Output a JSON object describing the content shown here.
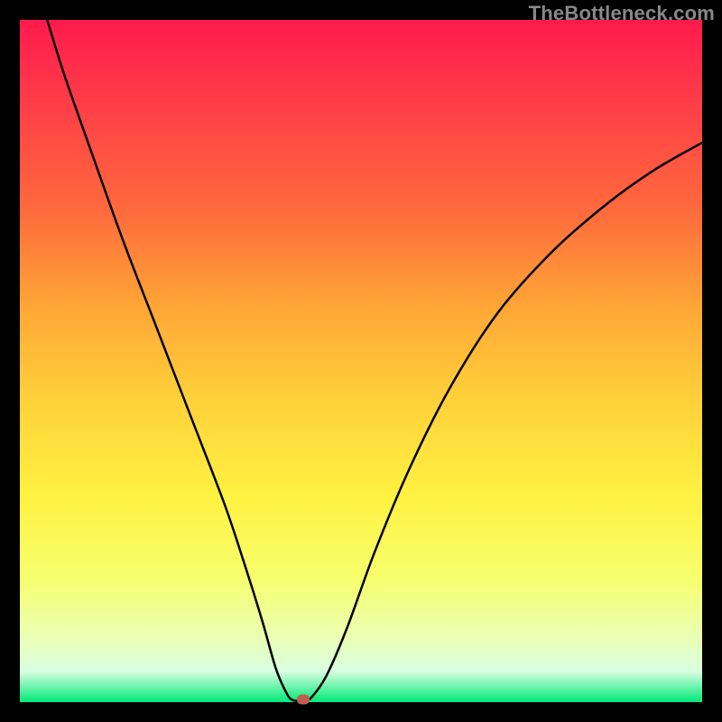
{
  "watermark": "TheBottleneck.com",
  "chart_data": {
    "type": "line",
    "title": "",
    "xlabel": "",
    "ylabel": "",
    "xlim": [
      0,
      100
    ],
    "ylim": [
      0,
      100
    ],
    "gradient_stops": [
      {
        "offset": 0.0,
        "color": "#ff1a4d"
      },
      {
        "offset": 0.12,
        "color": "#ff3d48"
      },
      {
        "offset": 0.28,
        "color": "#ff6a3c"
      },
      {
        "offset": 0.42,
        "color": "#ffa636"
      },
      {
        "offset": 0.56,
        "color": "#ffd23a"
      },
      {
        "offset": 0.7,
        "color": "#fff242"
      },
      {
        "offset": 0.82,
        "color": "#f6ff6e"
      },
      {
        "offset": 0.9,
        "color": "#ecffb0"
      },
      {
        "offset": 0.955,
        "color": "#d8ffe0"
      },
      {
        "offset": 1.0,
        "color": "#00e878"
      }
    ],
    "series": [
      {
        "name": "bottleneck-curve",
        "points": [
          {
            "x": 4.0,
            "y": 100.0
          },
          {
            "x": 6.5,
            "y": 92.0
          },
          {
            "x": 10.0,
            "y": 82.0
          },
          {
            "x": 15.0,
            "y": 68.0
          },
          {
            "x": 20.0,
            "y": 55.0
          },
          {
            "x": 25.0,
            "y": 42.0
          },
          {
            "x": 30.0,
            "y": 29.0
          },
          {
            "x": 33.0,
            "y": 20.0
          },
          {
            "x": 35.5,
            "y": 12.0
          },
          {
            "x": 37.5,
            "y": 5.0
          },
          {
            "x": 39.0,
            "y": 1.5
          },
          {
            "x": 40.0,
            "y": 0.3
          },
          {
            "x": 42.0,
            "y": 0.3
          },
          {
            "x": 43.0,
            "y": 1.0
          },
          {
            "x": 45.0,
            "y": 4.0
          },
          {
            "x": 48.0,
            "y": 11.0
          },
          {
            "x": 52.0,
            "y": 22.0
          },
          {
            "x": 57.0,
            "y": 34.0
          },
          {
            "x": 63.0,
            "y": 46.0
          },
          {
            "x": 70.0,
            "y": 57.0
          },
          {
            "x": 78.0,
            "y": 66.0
          },
          {
            "x": 86.0,
            "y": 73.0
          },
          {
            "x": 93.0,
            "y": 78.0
          },
          {
            "x": 100.0,
            "y": 82.0
          }
        ]
      }
    ],
    "marker": {
      "x": 41.5,
      "y": 0.4,
      "color": "#c55b4f"
    }
  }
}
